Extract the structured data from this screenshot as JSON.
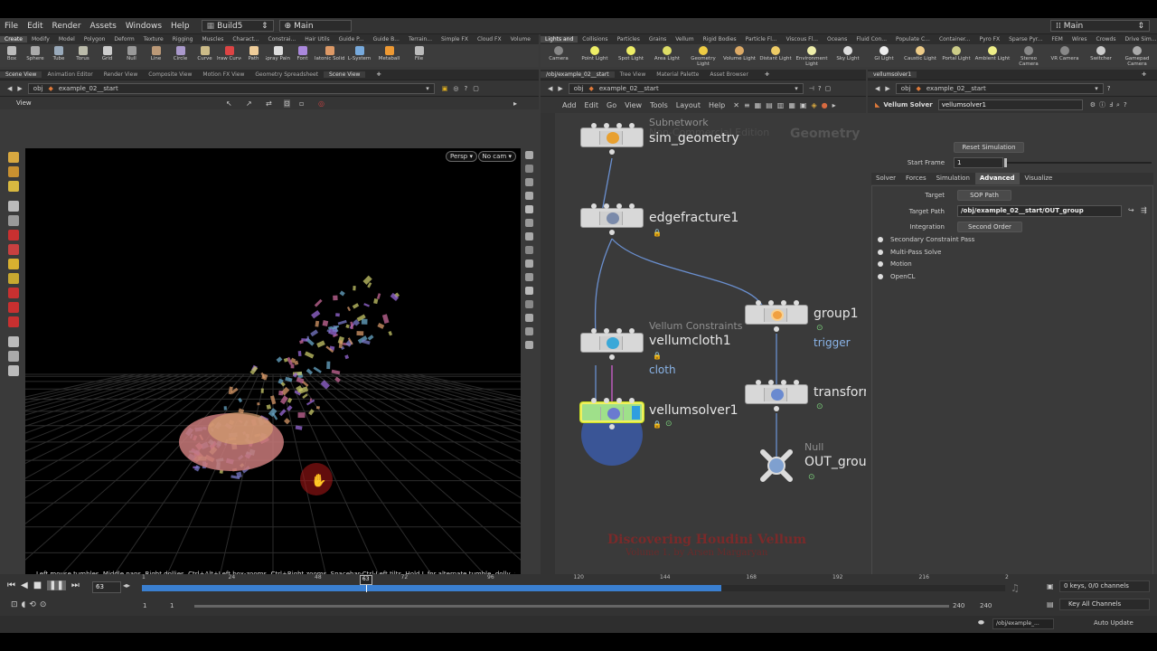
{
  "menu": {
    "file": "File",
    "edit": "Edit",
    "render": "Render",
    "assets": "Assets",
    "windows": "Windows",
    "help": "Help",
    "desktop1": "Build5",
    "desktop2": "Main",
    "right_desktop": "Main"
  },
  "shelf_left_tabs": [
    "Create",
    "Modify",
    "Model",
    "Polygon",
    "Deform",
    "Texture",
    "Rigging",
    "Muscles",
    "Charact...",
    "Constrai...",
    "Hair Utils",
    "Guide P...",
    "Guide B...",
    "Terrain...",
    "Simple FX",
    "Cloud FX",
    "Volume"
  ],
  "shelf_left_tools": [
    "Box",
    "Sphere",
    "Tube",
    "Torus",
    "Grid",
    "Null",
    "Line",
    "Circle",
    "Curve",
    "Draw Curve",
    "Path",
    "Spray Paint",
    "Font",
    "Platonic Solids",
    "L-System",
    "Metaball",
    "File"
  ],
  "shelf_right_tabs": [
    "Lights and",
    "Collisions",
    "Particles",
    "Grains",
    "Vellum",
    "Rigid Bodies",
    "Particle Fl...",
    "Viscous Fl...",
    "Oceans",
    "Fluid Con...",
    "Populate C...",
    "Container...",
    "Pyro FX",
    "Sparse Pyr...",
    "FEM",
    "Wires",
    "Crowds",
    "Drive Sim..."
  ],
  "shelf_right_tools": [
    "Camera",
    "Point Light",
    "Spot Light",
    "Area Light",
    "Geometry Light",
    "Volume Light",
    "Distant Light",
    "Environment Light",
    "Sky Light",
    "GI Light",
    "Caustic Light",
    "Portal Light",
    "Ambient Light",
    "Stereo Camera",
    "VR Camera",
    "Switcher",
    "Gamepad Camera"
  ],
  "viewer": {
    "tabs": [
      "Scene View",
      "Animation Editor",
      "Render View",
      "Composite View",
      "Motion FX View",
      "Geometry Spreadsheet",
      "Scene View"
    ],
    "path_obj": "obj",
    "path_node": "example_02__start",
    "title": "View",
    "persp": "Persp ▾",
    "cam": "No cam ▾",
    "hint": "Left mouse tumbles. Middle pans. Right dollies. Ctrl+Alt+Left box-zooms. Ctrl+Right zooms. Spacebar-Ctrl-Left tilts. Hold L for alternate tumble, dolly, and zoom."
  },
  "network": {
    "tabs": [
      "/obj/example_02__start",
      "Tree View",
      "Material Palette",
      "Asset Browser"
    ],
    "path_obj": "obj",
    "path_node": "example_02__start",
    "menu": [
      "Add",
      "Edit",
      "Go",
      "View",
      "Tools",
      "Layout",
      "Help"
    ],
    "watermark_edition": "Non-Commercial Edition",
    "watermark_context": "Geometry",
    "credit_title": "Discovering Houdini Vellum",
    "credit_sub": "Volume 1.   by Arsen Margaryan",
    "nodes": {
      "sim_geometry": {
        "type": "Subnetwork",
        "name": "sim_geometry"
      },
      "edgefracture": {
        "name": "edgefracture1"
      },
      "group": {
        "name": "group1",
        "flag": "trigger"
      },
      "vellumcloth": {
        "type": "Vellum Constraints",
        "name": "vellumcloth1",
        "flag": "cloth"
      },
      "transform": {
        "name": "transform"
      },
      "vellumsolver": {
        "name": "vellumsolver1"
      },
      "outgroup": {
        "type": "Null",
        "name": "OUT_group"
      }
    }
  },
  "params": {
    "tab": "vellumsolver1",
    "path_obj": "obj",
    "path_node": "example_02__start",
    "node_type": "Vellum Solver",
    "node_name": "vellumsolver1",
    "reset_btn": "Reset Simulation",
    "start_frame_label": "Start Frame",
    "start_frame": "1",
    "tabs": [
      "Solver",
      "Forces",
      "Simulation",
      "Advanced",
      "Visualize"
    ],
    "active_tab": "Advanced",
    "target_label": "Target",
    "target_value": "SOP Path",
    "target_path_label": "Target Path",
    "target_path": "/obj/example_02__start/OUT_group",
    "integration_label": "Integration",
    "integration_value": "Second Order",
    "toggles": [
      "Secondary Constraint Pass",
      "Multi-Pass Solve",
      "Motion",
      "OpenCL"
    ]
  },
  "timeline": {
    "frame": "63",
    "marker": "63",
    "ticks": [
      "1",
      "24",
      "48",
      "72",
      "96",
      "120",
      "144",
      "168",
      "192",
      "216",
      "2"
    ],
    "start": "1",
    "start2": "1",
    "end": "240",
    "end2": "240",
    "keys": "0 keys, 0/0 channels",
    "key_all": "Key All Channels",
    "status_path": "/obj/example_...",
    "update": "Auto Update",
    "progress": 0.75
  },
  "colors": {
    "accent": "#2f7ed8",
    "solver_node": "#9fe08a",
    "playbar": "#3a7fd0"
  }
}
